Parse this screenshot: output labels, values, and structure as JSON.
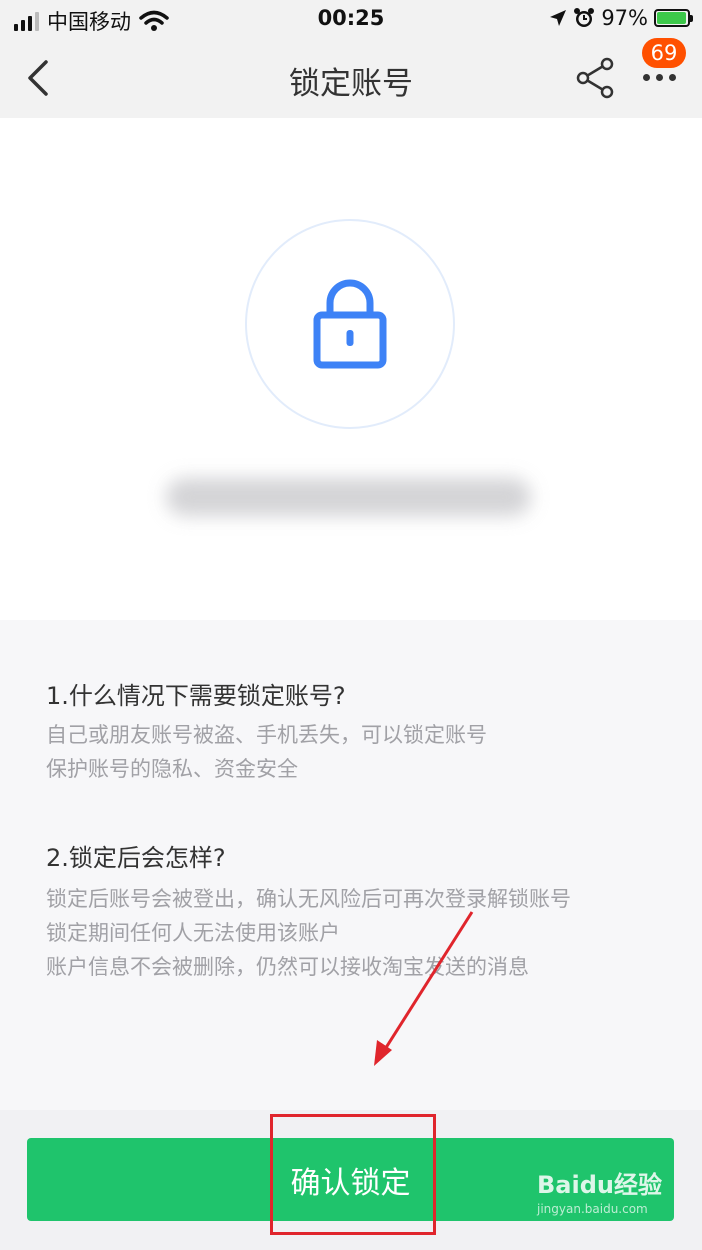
{
  "status_bar": {
    "carrier": "中国移动",
    "time": "00:25",
    "battery_percent": "97%",
    "battery_level": 0.97,
    "icons": [
      "signal-icon",
      "wifi-icon",
      "location-icon",
      "alarm-icon",
      "battery-icon"
    ]
  },
  "navbar": {
    "title": "锁定账号",
    "badge_count": "69",
    "icons": [
      "back-arrow-icon",
      "share-icon",
      "more-icon"
    ]
  },
  "hero": {
    "icon": "lock-icon",
    "accent_color": "#3d82f6"
  },
  "info": {
    "q1": "1.什么情况下需要锁定账号?",
    "a1": [
      "自己或朋友账号被盗、手机丢失，可以锁定账号",
      "保护账号的隐私、资金安全"
    ],
    "q2": "2.锁定后会怎样?",
    "a2": [
      "锁定后账号会被登出，确认无风险后可再次登录解锁账号",
      "锁定期间任何人无法使用该账户",
      "账户信息不会被删除，仍然可以接收淘宝发送的消息"
    ]
  },
  "bottom": {
    "confirm_label": "确认锁定",
    "button_color": "#1fc46c"
  },
  "watermark": {
    "text": "Baidu经验",
    "url": "jingyan.baidu.com"
  },
  "annotation_color": "#e0252c"
}
